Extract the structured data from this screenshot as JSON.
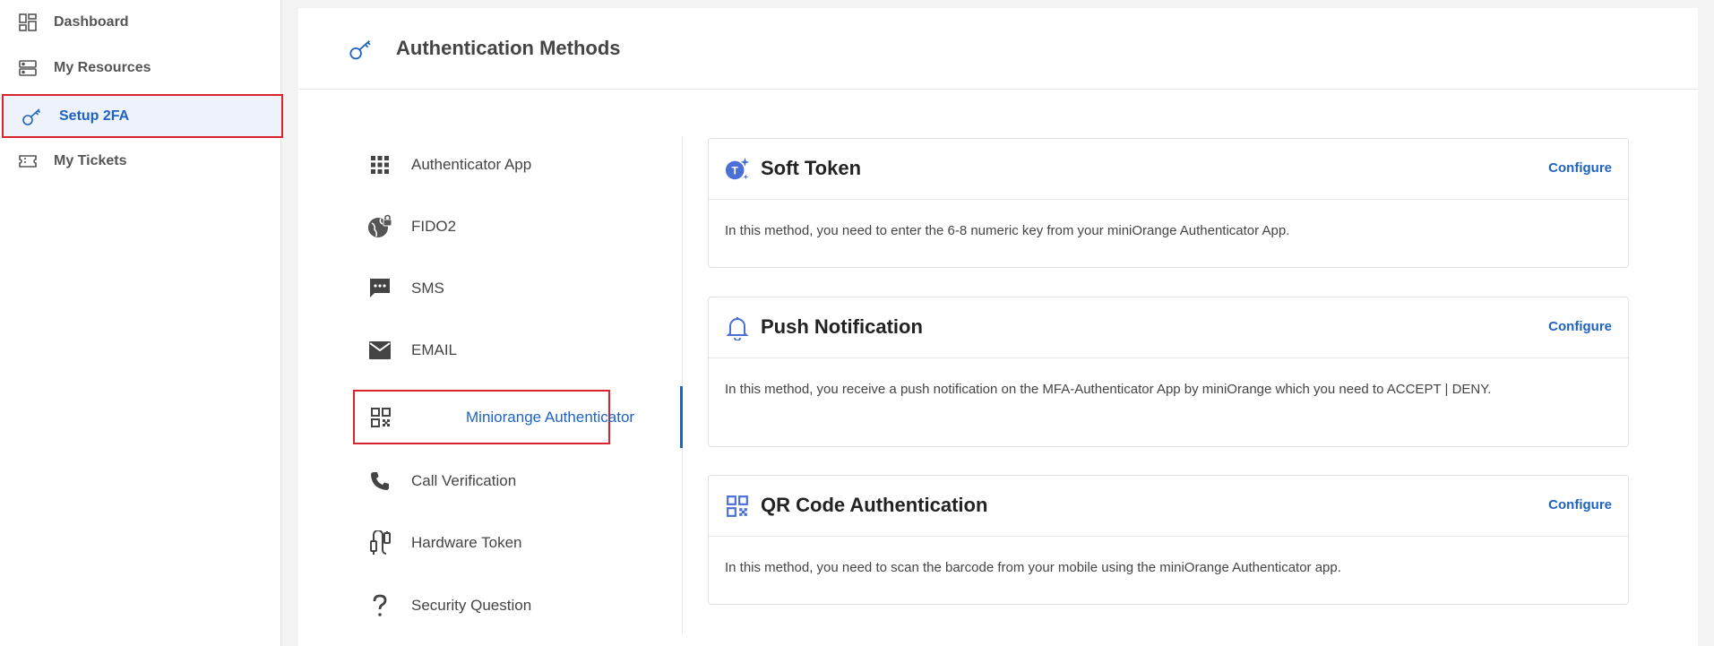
{
  "sidebar": {
    "items": [
      {
        "label": "Dashboard",
        "icon": "dashboard-icon"
      },
      {
        "label": "My Resources",
        "icon": "resources-icon"
      },
      {
        "label": "Setup 2FA",
        "icon": "key-icon",
        "active": true
      },
      {
        "label": "My Tickets",
        "icon": "ticket-icon"
      }
    ]
  },
  "header": {
    "title": "Authentication Methods",
    "icon": "key-icon"
  },
  "methods": [
    {
      "label": "Authenticator App",
      "icon": "grid-icon"
    },
    {
      "label": "FIDO2",
      "icon": "globe-lock-icon"
    },
    {
      "label": "SMS",
      "icon": "sms-icon"
    },
    {
      "label": "EMAIL",
      "icon": "email-icon"
    },
    {
      "label": "Miniorange Authenticator",
      "icon": "qr-icon",
      "active": true
    },
    {
      "label": "Call Verification",
      "icon": "phone-icon"
    },
    {
      "label": "Hardware Token",
      "icon": "hardware-token-icon"
    },
    {
      "label": "Security Question",
      "icon": "question-icon"
    }
  ],
  "cards": [
    {
      "title": "Soft Token",
      "icon": "soft-token-icon",
      "configure": "Configure",
      "description": "In this method, you need to enter the 6-8 numeric key from your miniOrange Authenticator App."
    },
    {
      "title": "Push Notification",
      "icon": "bell-icon",
      "configure": "Configure",
      "description": "In this method, you receive a push notification on the MFA-Authenticator App by miniOrange which you need to ACCEPT | DENY."
    },
    {
      "title": "QR Code Authentication",
      "icon": "qr-icon",
      "configure": "Configure",
      "description": "In this method, you need to scan the barcode from your mobile using the miniOrange Authenticator app."
    }
  ],
  "colors": {
    "accent": "#1e63c2",
    "highlight": "#d9232d",
    "text": "#444444"
  }
}
